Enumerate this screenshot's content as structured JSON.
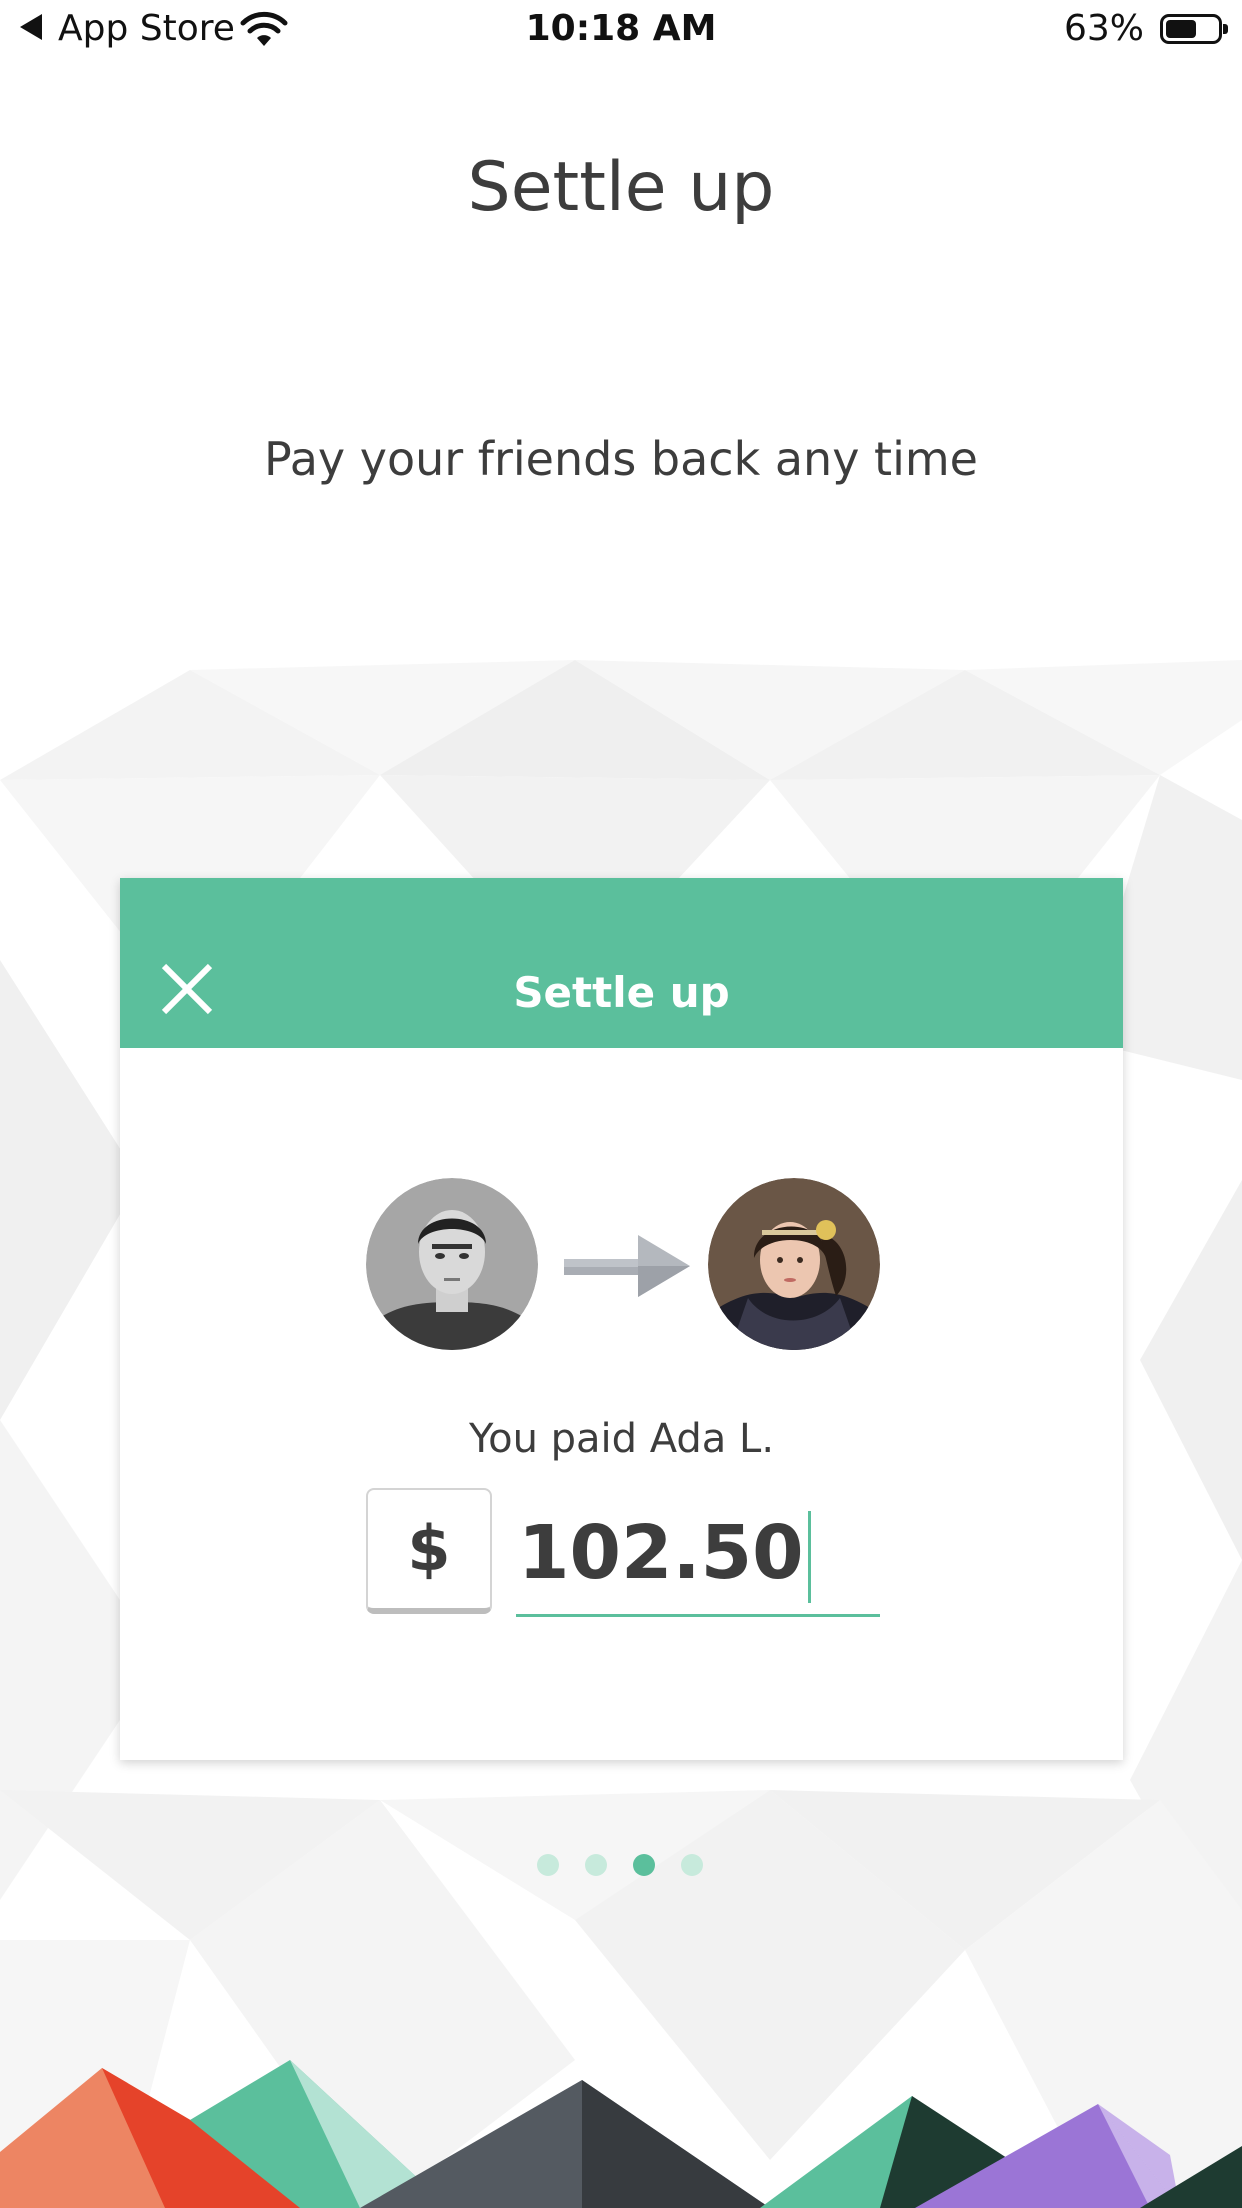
{
  "status_bar": {
    "back_app": "App Store",
    "time": "10:18 AM",
    "battery_percent": "63%",
    "battery_level": 0.63
  },
  "onboarding": {
    "title": "Settle up",
    "subtitle": "Pay your friends back any time",
    "page_count": 4,
    "current_page": 3
  },
  "card": {
    "header_title": "Settle up",
    "paid_text": "You paid Ada L.",
    "currency_symbol": "$",
    "amount": "102.50",
    "accent_color": "#5bbf9c"
  },
  "icons": {
    "close": "close-icon",
    "arrow": "arrow-right-icon",
    "back": "back-arrow-icon",
    "wifi": "wifi-icon",
    "battery": "battery-icon"
  }
}
